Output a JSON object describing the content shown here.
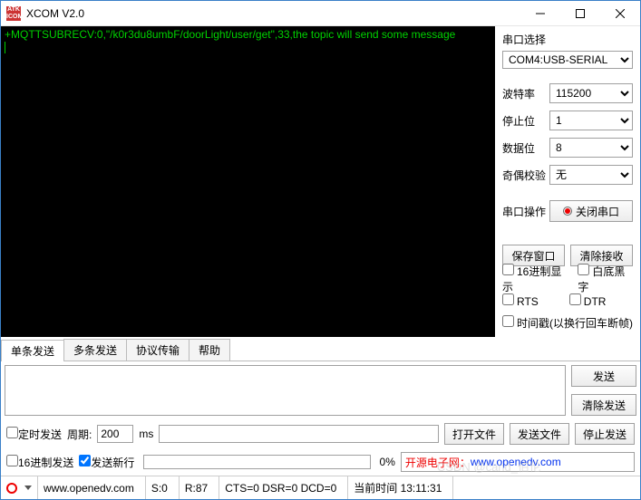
{
  "window": {
    "title": "XCOM V2.0"
  },
  "terminal": {
    "line1": "+MQTTSUBRECV:0,\"/k0r3du8umbF/doorLight/user/get\",33,the topic will send some message"
  },
  "right": {
    "port_label": "串口选择",
    "port_value": "COM4:USB-SERIAL",
    "baud_label": "波特率",
    "baud_value": "115200",
    "stop_label": "停止位",
    "stop_value": "1",
    "data_label": "数据位",
    "data_value": "8",
    "parity_label": "奇偶校验",
    "parity_value": "无",
    "op_label": "串口操作",
    "op_btn": "关闭串口",
    "save_btn": "保存窗口",
    "clear_btn": "清除接收",
    "hex_disp": "16进制显示",
    "bw": "白底黑字",
    "rts": "RTS",
    "dtr": "DTR",
    "ts": "时间戳(以换行回车断帧)"
  },
  "tabs": {
    "t1": "单条发送",
    "t2": "多条发送",
    "t3": "协议传输",
    "t4": "帮助"
  },
  "send": {
    "send_btn": "发送",
    "clear_send": "清除发送"
  },
  "opts": {
    "timed": "定时发送",
    "period_lbl": "周期:",
    "period_val": "200",
    "ms": "ms",
    "open_file": "打开文件",
    "send_file": "发送文件",
    "stop_send": "停止发送",
    "hex_send": "16进制发送",
    "newline": "发送新行",
    "pct": "0%",
    "promo_lbl": "开源电子网：",
    "promo_url": "www.openedv.com"
  },
  "status": {
    "site": "www.openedv.com",
    "s": "S:0",
    "r": "R:87",
    "cts": "CTS=0 DSR=0 DCD=0",
    "time": "当前时间 13:11:31"
  },
  "watermark": "CSDN @cand_伯伦"
}
